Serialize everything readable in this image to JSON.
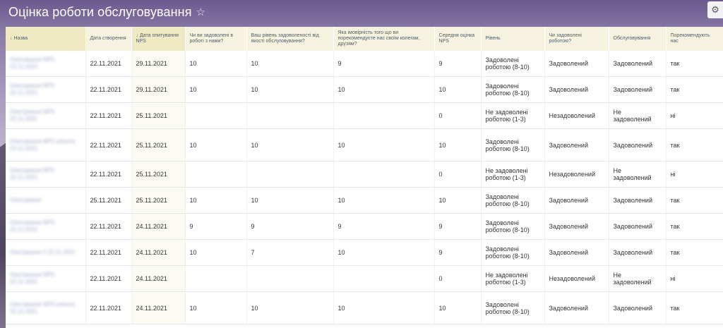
{
  "page": {
    "title": "Оцінка роботи обслуговування",
    "favorite_icon": "☆",
    "settings_icon": "⚙"
  },
  "columns": [
    {
      "label": "Назва",
      "sorted": true
    },
    {
      "label": "Дата створення",
      "sorted": false
    },
    {
      "label": "Дата опитування NPS",
      "sorted": true
    },
    {
      "label": "Чи ви задоволені в роботі з нами?",
      "sorted": false
    },
    {
      "label": "Ваш рівень задоволеності від якості обслуговування?",
      "sorted": false
    },
    {
      "label": "Яка імовірність того що ви порекомендуєте нас своїм колегам, друзям?",
      "sorted": false
    },
    {
      "label": "Середня оцінка NPS",
      "sorted": false
    },
    {
      "label": "Рівень",
      "sorted": false
    },
    {
      "label": "Чи задоволені роботою?",
      "sorted": false
    },
    {
      "label": "Обслуговування",
      "sorted": false
    },
    {
      "label": "Порекомендують нас",
      "sorted": false
    }
  ],
  "rows": [
    {
      "name": "Опитування NPS 22.11.2021",
      "created": "22.11.2021",
      "survey": "29.11.2021",
      "q1": "10",
      "q2": "10",
      "q3": "9",
      "avg": "9",
      "level": "Задоволені роботою (8-10)",
      "satisfied": "Задоволений",
      "service": "Задоволений",
      "recommend": "так"
    },
    {
      "name": "Опитування NPS 22.11.2021",
      "created": "22.11.2021",
      "survey": "29.11.2021",
      "q1": "10",
      "q2": "10",
      "q3": "10",
      "avg": "10",
      "level": "Задоволені роботою (8-10)",
      "satisfied": "Задоволений",
      "service": "Задоволений",
      "recommend": "так"
    },
    {
      "name": "Опитування NPS 22.11.2021",
      "created": "22.11.2021",
      "survey": "25.11.2021",
      "q1": "",
      "q2": "",
      "q3": "",
      "avg": "0",
      "level": "Не задоволені роботою (1-3)",
      "satisfied": "Незадоволений",
      "service": "Не задоволений",
      "recommend": "ні"
    },
    {
      "name": "Опитування NPS клієнта 22.11.2021",
      "created": "22.11.2021",
      "survey": "25.11.2021",
      "q1": "10",
      "q2": "10",
      "q3": "10",
      "avg": "10",
      "level": "Задоволені роботою (8-10)",
      "satisfied": "Задоволений",
      "service": "Задоволений",
      "recommend": "так"
    },
    {
      "name": "Опитування NPS 22.11.2021",
      "created": "22.11.2021",
      "survey": "25.11.2021",
      "q1": "",
      "q2": "",
      "q3": "",
      "avg": "0",
      "level": "Не задоволені роботою (1-3)",
      "satisfied": "Незадоволений",
      "service": "Не задоволений",
      "recommend": "ні"
    },
    {
      "name": "Опитування",
      "created": "25.11.2021",
      "survey": "25.11.2021",
      "q1": "10",
      "q2": "10",
      "q3": "10",
      "avg": "10",
      "level": "Задоволені роботою (8-10)",
      "satisfied": "Задоволений",
      "service": "Задоволений",
      "recommend": "так"
    },
    {
      "name": "Опитування NPS 22.11.2021",
      "created": "22.11.2021",
      "survey": "24.11.2021",
      "q1": "9",
      "q2": "9",
      "q3": "9",
      "avg": "9",
      "level": "Задоволені роботою (8-10)",
      "satisfied": "Задоволений",
      "service": "Задоволений",
      "recommend": "так"
    },
    {
      "name": "Опитування 2 22.11.2021",
      "created": "22.11.2021",
      "survey": "24.11.2021",
      "q1": "10",
      "q2": "7",
      "q3": "10",
      "avg": "9",
      "level": "Задоволені роботою (8-10)",
      "satisfied": "Задоволений",
      "service": "Задоволений",
      "recommend": "так"
    },
    {
      "name": "Опитування NPS 22.11.2021",
      "created": "22.11.2021",
      "survey": "24.11.2021",
      "q1": "",
      "q2": "",
      "q3": "",
      "avg": "0",
      "level": "Не задоволені роботою (1-3)",
      "satisfied": "Незадоволений",
      "service": "Не задоволений",
      "recommend": "ні"
    },
    {
      "name": "Опитування NPS клієнта 22.11.2021",
      "created": "22.11.2021",
      "survey": "24.11.2021",
      "q1": "10",
      "q2": "10",
      "q3": "10",
      "avg": "10",
      "level": "Задоволені роботою (8-10)",
      "satisfied": "Задоволений",
      "service": "Задоволений",
      "recommend": "так"
    }
  ]
}
